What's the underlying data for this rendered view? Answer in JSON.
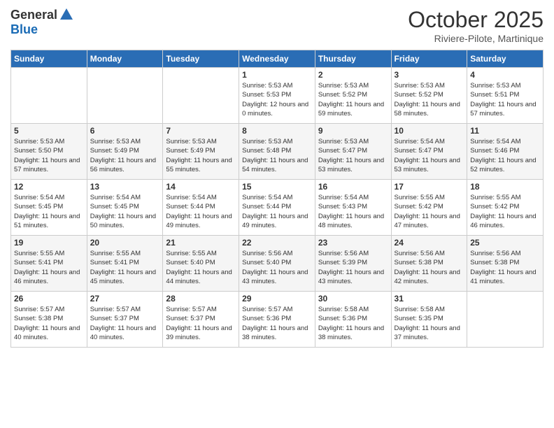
{
  "logo": {
    "general": "General",
    "blue": "Blue"
  },
  "title": "October 2025",
  "location": "Riviere-Pilote, Martinique",
  "days_header": [
    "Sunday",
    "Monday",
    "Tuesday",
    "Wednesday",
    "Thursday",
    "Friday",
    "Saturday"
  ],
  "weeks": [
    [
      {
        "num": "",
        "sunrise": "",
        "sunset": "",
        "daylight": ""
      },
      {
        "num": "",
        "sunrise": "",
        "sunset": "",
        "daylight": ""
      },
      {
        "num": "",
        "sunrise": "",
        "sunset": "",
        "daylight": ""
      },
      {
        "num": "1",
        "sunrise": "Sunrise: 5:53 AM",
        "sunset": "Sunset: 5:53 PM",
        "daylight": "Daylight: 12 hours and 0 minutes."
      },
      {
        "num": "2",
        "sunrise": "Sunrise: 5:53 AM",
        "sunset": "Sunset: 5:52 PM",
        "daylight": "Daylight: 11 hours and 59 minutes."
      },
      {
        "num": "3",
        "sunrise": "Sunrise: 5:53 AM",
        "sunset": "Sunset: 5:52 PM",
        "daylight": "Daylight: 11 hours and 58 minutes."
      },
      {
        "num": "4",
        "sunrise": "Sunrise: 5:53 AM",
        "sunset": "Sunset: 5:51 PM",
        "daylight": "Daylight: 11 hours and 57 minutes."
      }
    ],
    [
      {
        "num": "5",
        "sunrise": "Sunrise: 5:53 AM",
        "sunset": "Sunset: 5:50 PM",
        "daylight": "Daylight: 11 hours and 57 minutes."
      },
      {
        "num": "6",
        "sunrise": "Sunrise: 5:53 AM",
        "sunset": "Sunset: 5:49 PM",
        "daylight": "Daylight: 11 hours and 56 minutes."
      },
      {
        "num": "7",
        "sunrise": "Sunrise: 5:53 AM",
        "sunset": "Sunset: 5:49 PM",
        "daylight": "Daylight: 11 hours and 55 minutes."
      },
      {
        "num": "8",
        "sunrise": "Sunrise: 5:53 AM",
        "sunset": "Sunset: 5:48 PM",
        "daylight": "Daylight: 11 hours and 54 minutes."
      },
      {
        "num": "9",
        "sunrise": "Sunrise: 5:53 AM",
        "sunset": "Sunset: 5:47 PM",
        "daylight": "Daylight: 11 hours and 53 minutes."
      },
      {
        "num": "10",
        "sunrise": "Sunrise: 5:54 AM",
        "sunset": "Sunset: 5:47 PM",
        "daylight": "Daylight: 11 hours and 53 minutes."
      },
      {
        "num": "11",
        "sunrise": "Sunrise: 5:54 AM",
        "sunset": "Sunset: 5:46 PM",
        "daylight": "Daylight: 11 hours and 52 minutes."
      }
    ],
    [
      {
        "num": "12",
        "sunrise": "Sunrise: 5:54 AM",
        "sunset": "Sunset: 5:45 PM",
        "daylight": "Daylight: 11 hours and 51 minutes."
      },
      {
        "num": "13",
        "sunrise": "Sunrise: 5:54 AM",
        "sunset": "Sunset: 5:45 PM",
        "daylight": "Daylight: 11 hours and 50 minutes."
      },
      {
        "num": "14",
        "sunrise": "Sunrise: 5:54 AM",
        "sunset": "Sunset: 5:44 PM",
        "daylight": "Daylight: 11 hours and 49 minutes."
      },
      {
        "num": "15",
        "sunrise": "Sunrise: 5:54 AM",
        "sunset": "Sunset: 5:44 PM",
        "daylight": "Daylight: 11 hours and 49 minutes."
      },
      {
        "num": "16",
        "sunrise": "Sunrise: 5:54 AM",
        "sunset": "Sunset: 5:43 PM",
        "daylight": "Daylight: 11 hours and 48 minutes."
      },
      {
        "num": "17",
        "sunrise": "Sunrise: 5:55 AM",
        "sunset": "Sunset: 5:42 PM",
        "daylight": "Daylight: 11 hours and 47 minutes."
      },
      {
        "num": "18",
        "sunrise": "Sunrise: 5:55 AM",
        "sunset": "Sunset: 5:42 PM",
        "daylight": "Daylight: 11 hours and 46 minutes."
      }
    ],
    [
      {
        "num": "19",
        "sunrise": "Sunrise: 5:55 AM",
        "sunset": "Sunset: 5:41 PM",
        "daylight": "Daylight: 11 hours and 46 minutes."
      },
      {
        "num": "20",
        "sunrise": "Sunrise: 5:55 AM",
        "sunset": "Sunset: 5:41 PM",
        "daylight": "Daylight: 11 hours and 45 minutes."
      },
      {
        "num": "21",
        "sunrise": "Sunrise: 5:55 AM",
        "sunset": "Sunset: 5:40 PM",
        "daylight": "Daylight: 11 hours and 44 minutes."
      },
      {
        "num": "22",
        "sunrise": "Sunrise: 5:56 AM",
        "sunset": "Sunset: 5:40 PM",
        "daylight": "Daylight: 11 hours and 43 minutes."
      },
      {
        "num": "23",
        "sunrise": "Sunrise: 5:56 AM",
        "sunset": "Sunset: 5:39 PM",
        "daylight": "Daylight: 11 hours and 43 minutes."
      },
      {
        "num": "24",
        "sunrise": "Sunrise: 5:56 AM",
        "sunset": "Sunset: 5:38 PM",
        "daylight": "Daylight: 11 hours and 42 minutes."
      },
      {
        "num": "25",
        "sunrise": "Sunrise: 5:56 AM",
        "sunset": "Sunset: 5:38 PM",
        "daylight": "Daylight: 11 hours and 41 minutes."
      }
    ],
    [
      {
        "num": "26",
        "sunrise": "Sunrise: 5:57 AM",
        "sunset": "Sunset: 5:38 PM",
        "daylight": "Daylight: 11 hours and 40 minutes."
      },
      {
        "num": "27",
        "sunrise": "Sunrise: 5:57 AM",
        "sunset": "Sunset: 5:37 PM",
        "daylight": "Daylight: 11 hours and 40 minutes."
      },
      {
        "num": "28",
        "sunrise": "Sunrise: 5:57 AM",
        "sunset": "Sunset: 5:37 PM",
        "daylight": "Daylight: 11 hours and 39 minutes."
      },
      {
        "num": "29",
        "sunrise": "Sunrise: 5:57 AM",
        "sunset": "Sunset: 5:36 PM",
        "daylight": "Daylight: 11 hours and 38 minutes."
      },
      {
        "num": "30",
        "sunrise": "Sunrise: 5:58 AM",
        "sunset": "Sunset: 5:36 PM",
        "daylight": "Daylight: 11 hours and 38 minutes."
      },
      {
        "num": "31",
        "sunrise": "Sunrise: 5:58 AM",
        "sunset": "Sunset: 5:35 PM",
        "daylight": "Daylight: 11 hours and 37 minutes."
      },
      {
        "num": "",
        "sunrise": "",
        "sunset": "",
        "daylight": ""
      }
    ]
  ]
}
